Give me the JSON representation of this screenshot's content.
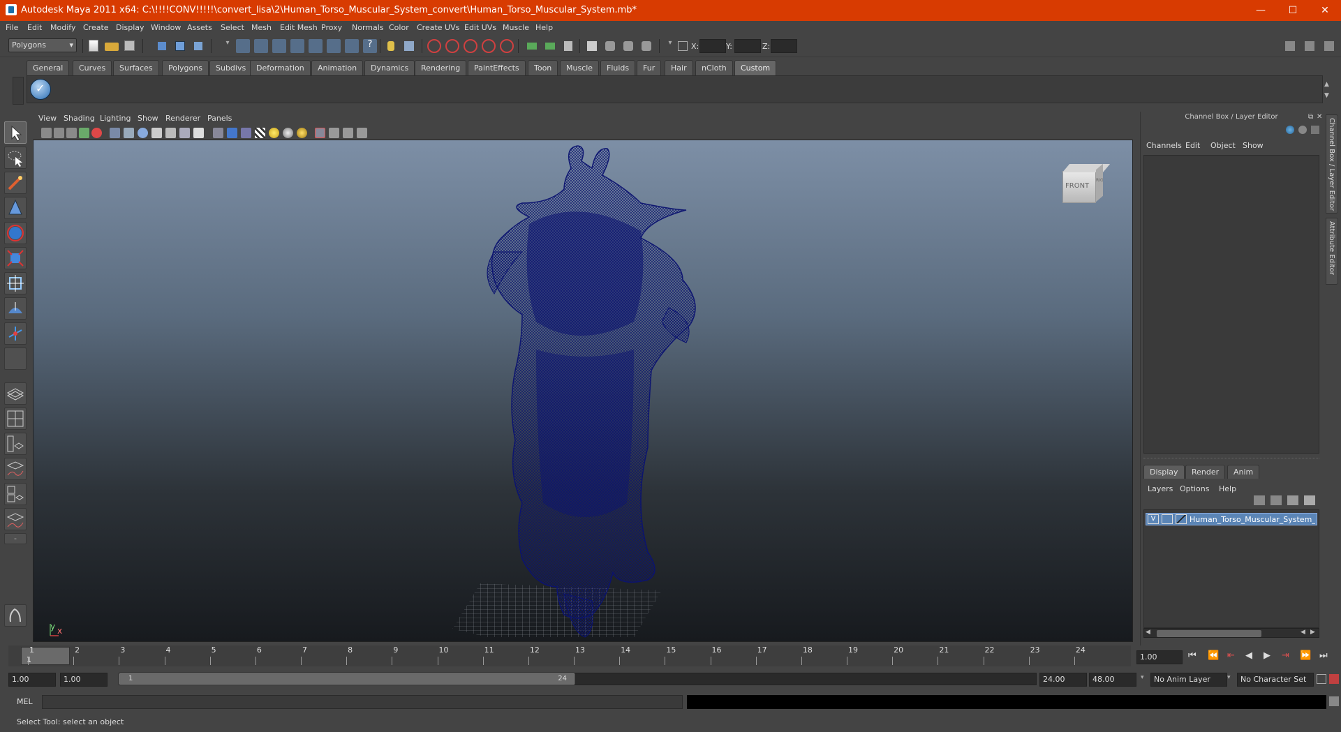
{
  "titlebar": {
    "title": "Autodesk Maya 2011 x64: C:\\!!!!CONV!!!!!\\convert_lisa\\2\\Human_Torso_Muscular_System_convert\\Human_Torso_Muscular_System.mb*",
    "minimize": "—",
    "maximize": "☐",
    "close": "✕"
  },
  "menubar": [
    "File",
    "Edit",
    "Modify",
    "Create",
    "Display",
    "Window",
    "Assets",
    "Select",
    "Mesh",
    "Edit Mesh",
    "Proxy",
    "Normals",
    "Color",
    "Create UVs",
    "Edit UVs",
    "Muscle",
    "Help"
  ],
  "statusline": {
    "mode": "Polygons",
    "x_label": "X:",
    "y_label": "Y:",
    "z_label": "Z:"
  },
  "shelf": {
    "tabs": [
      "General",
      "Curves",
      "Surfaces",
      "Polygons",
      "Subdivs",
      "Deformation",
      "Animation",
      "Dynamics",
      "Rendering",
      "PaintEffects",
      "Toon",
      "Muscle",
      "Fluids",
      "Fur",
      "Hair",
      "nCloth",
      "Custom"
    ],
    "active_tab": "Custom"
  },
  "viewport": {
    "menu": [
      "View",
      "Shading",
      "Lighting",
      "Show",
      "Renderer",
      "Panels"
    ],
    "viewcube_label": "FRONT",
    "viewcube_side": "RIGHT",
    "axis_y": "y",
    "axis_x": "x",
    "wire_color": "#0b1370"
  },
  "channelbox": {
    "header": "Channel Box / Layer Editor",
    "menu": [
      "Channels",
      "Edit",
      "Object",
      "Show"
    ],
    "layer_tabs": [
      "Display",
      "Render",
      "Anim"
    ],
    "active_layer_tab": "Display",
    "layer_menu": [
      "Layers",
      "Options",
      "Help"
    ],
    "layer": {
      "visible": "V",
      "name": "Human_Torso_Muscular_System_layer"
    }
  },
  "side_tabs": [
    "Channel Box / Layer Editor",
    "Attribute Editor"
  ],
  "timeslider": {
    "ticks": [
      "1",
      "2",
      "3",
      "4",
      "5",
      "6",
      "7",
      "8",
      "9",
      "10",
      "11",
      "12",
      "13",
      "14",
      "15",
      "16",
      "17",
      "18",
      "19",
      "20",
      "21",
      "22",
      "23",
      "24"
    ],
    "current_frame": "1",
    "current_time_field": "1.00"
  },
  "range": {
    "start_field": "1.00",
    "playback_start": "1.00",
    "bar_start": "1",
    "bar_end": "24",
    "playback_end": "24.00",
    "end_field": "48.00",
    "anim_layer": "No Anim Layer",
    "char_set": "No Character Set"
  },
  "commandline": {
    "label": "MEL"
  },
  "helpline": {
    "text": "Select Tool: select an object"
  }
}
